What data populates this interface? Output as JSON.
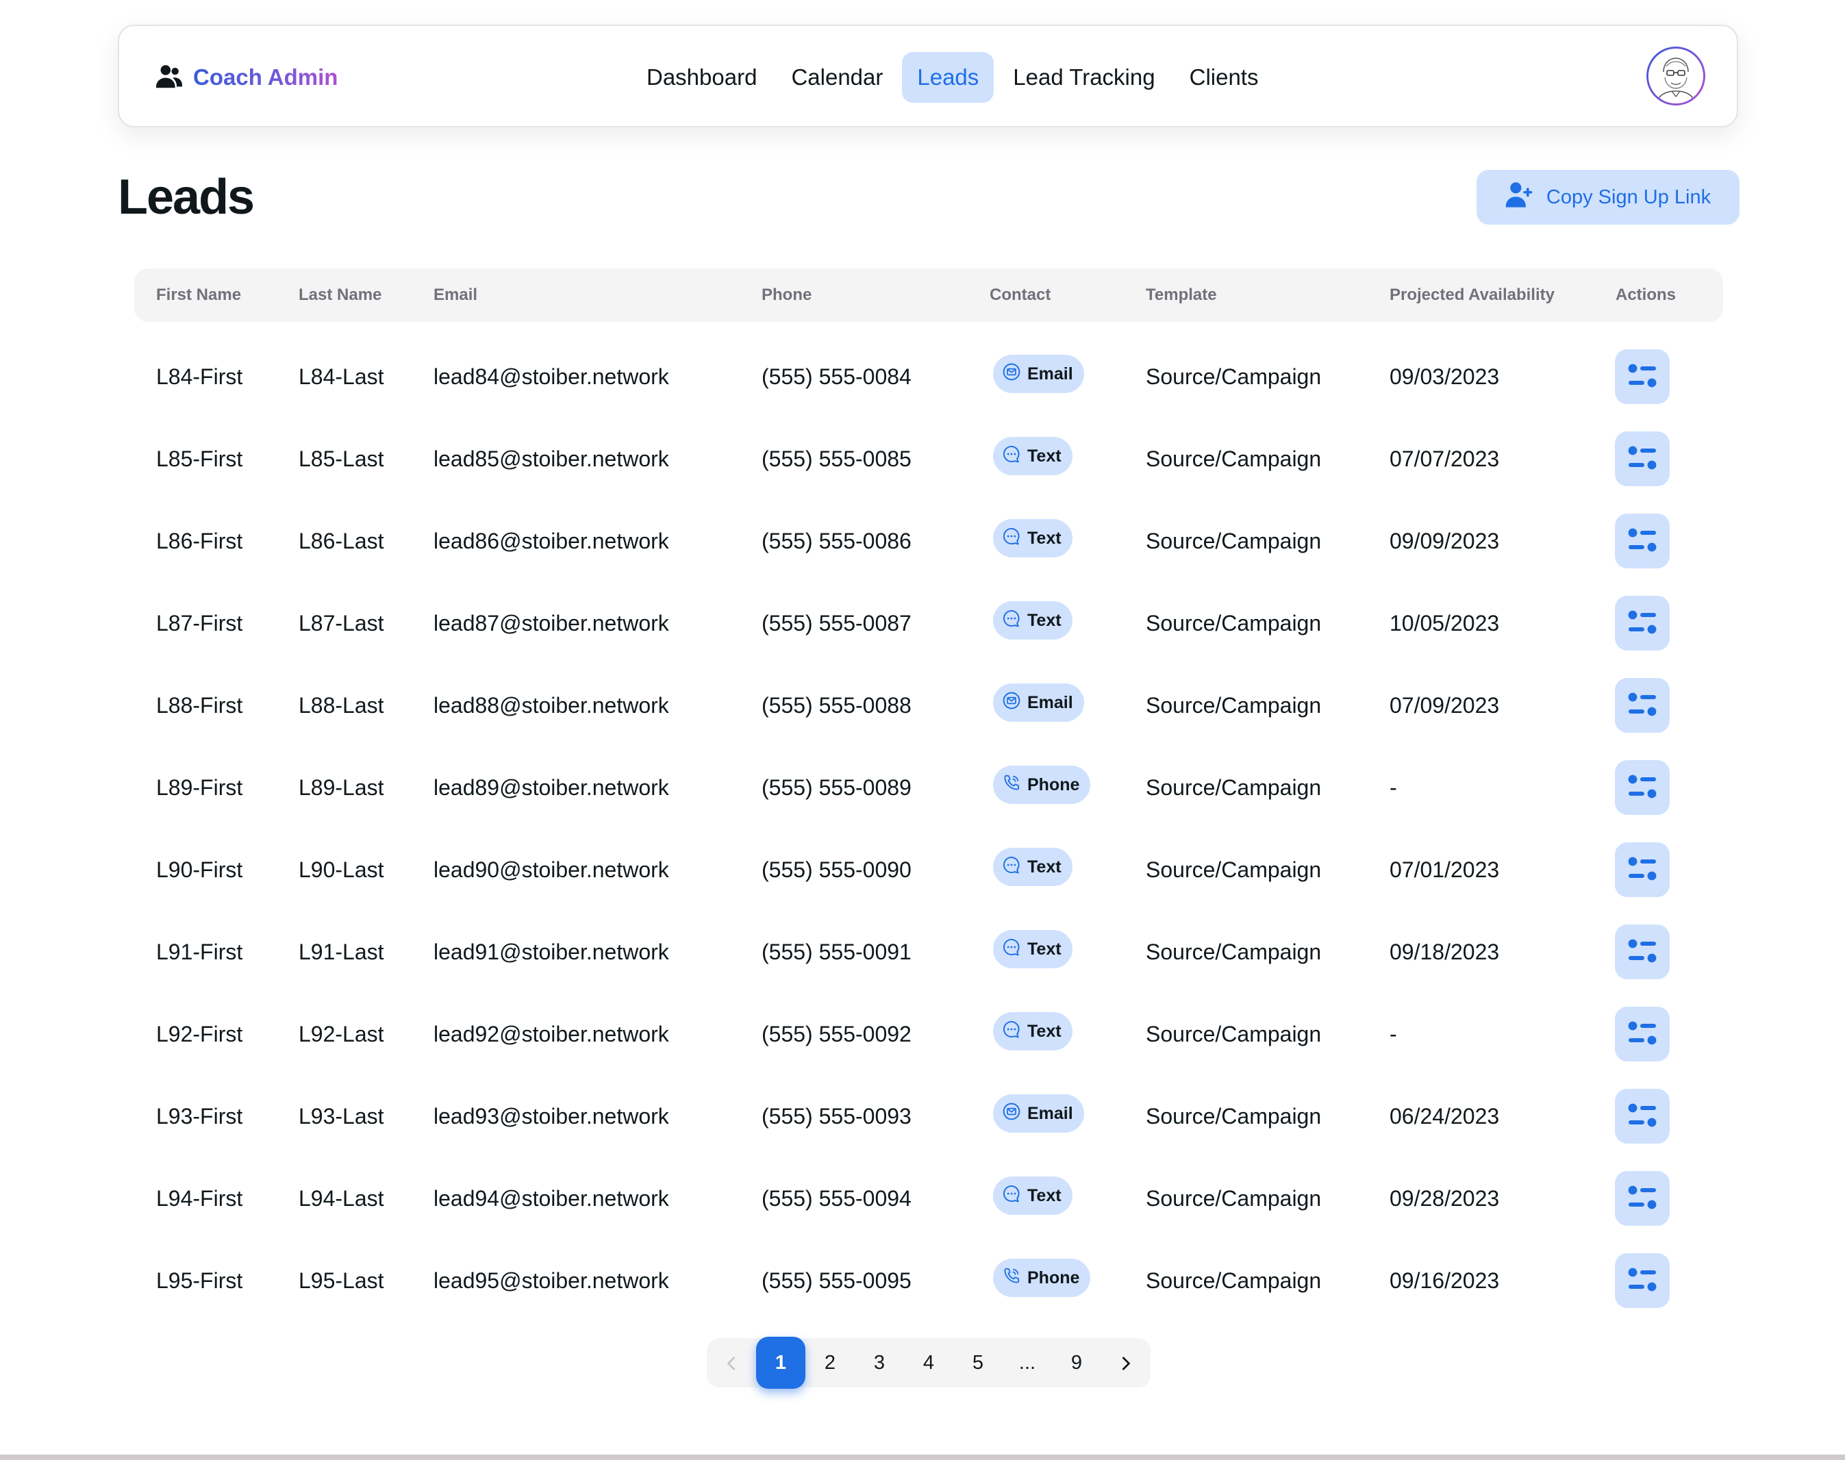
{
  "nav": {
    "brand": "Coach Admin",
    "links": [
      "Dashboard",
      "Calendar",
      "Leads",
      "Lead Tracking",
      "Clients"
    ],
    "active": "Leads",
    "brand_icon": "users-icon",
    "avatar_icon": "avatar-glasses-icon"
  },
  "page": {
    "title": "Leads",
    "copy_button": "Copy Sign Up Link",
    "copy_button_icon": "user-plus-icon"
  },
  "table": {
    "columns": [
      "First Name",
      "Last Name",
      "Email",
      "Phone",
      "Contact",
      "Template",
      "Projected Availability",
      "Actions"
    ],
    "rows": [
      {
        "first": "L84-First",
        "last": "L84-Last",
        "email": "lead84@stoiber.network",
        "phone": "(555) 555-0084",
        "contact": "Email",
        "contact_icon": "mail-icon",
        "template": "Source/Campaign",
        "availability": "09/03/2023"
      },
      {
        "first": "L85-First",
        "last": "L85-Last",
        "email": "lead85@stoiber.network",
        "phone": "(555) 555-0085",
        "contact": "Text",
        "contact_icon": "chat-icon",
        "template": "Source/Campaign",
        "availability": "07/07/2023"
      },
      {
        "first": "L86-First",
        "last": "L86-Last",
        "email": "lead86@stoiber.network",
        "phone": "(555) 555-0086",
        "contact": "Text",
        "contact_icon": "chat-icon",
        "template": "Source/Campaign",
        "availability": "09/09/2023"
      },
      {
        "first": "L87-First",
        "last": "L87-Last",
        "email": "lead87@stoiber.network",
        "phone": "(555) 555-0087",
        "contact": "Text",
        "contact_icon": "chat-icon",
        "template": "Source/Campaign",
        "availability": "10/05/2023"
      },
      {
        "first": "L88-First",
        "last": "L88-Last",
        "email": "lead88@stoiber.network",
        "phone": "(555) 555-0088",
        "contact": "Email",
        "contact_icon": "mail-icon",
        "template": "Source/Campaign",
        "availability": "07/09/2023"
      },
      {
        "first": "L89-First",
        "last": "L89-Last",
        "email": "lead89@stoiber.network",
        "phone": "(555) 555-0089",
        "contact": "Phone",
        "contact_icon": "phone-icon",
        "template": "Source/Campaign",
        "availability": "-"
      },
      {
        "first": "L90-First",
        "last": "L90-Last",
        "email": "lead90@stoiber.network",
        "phone": "(555) 555-0090",
        "contact": "Text",
        "contact_icon": "chat-icon",
        "template": "Source/Campaign",
        "availability": "07/01/2023"
      },
      {
        "first": "L91-First",
        "last": "L91-Last",
        "email": "lead91@stoiber.network",
        "phone": "(555) 555-0091",
        "contact": "Text",
        "contact_icon": "chat-icon",
        "template": "Source/Campaign",
        "availability": "09/18/2023"
      },
      {
        "first": "L92-First",
        "last": "L92-Last",
        "email": "lead92@stoiber.network",
        "phone": "(555) 555-0092",
        "contact": "Text",
        "contact_icon": "chat-icon",
        "template": "Source/Campaign",
        "availability": "-"
      },
      {
        "first": "L93-First",
        "last": "L93-Last",
        "email": "lead93@stoiber.network",
        "phone": "(555) 555-0093",
        "contact": "Email",
        "contact_icon": "mail-icon",
        "template": "Source/Campaign",
        "availability": "06/24/2023"
      },
      {
        "first": "L94-First",
        "last": "L94-Last",
        "email": "lead94@stoiber.network",
        "phone": "(555) 555-0094",
        "contact": "Text",
        "contact_icon": "chat-icon",
        "template": "Source/Campaign",
        "availability": "09/28/2023"
      },
      {
        "first": "L95-First",
        "last": "L95-Last",
        "email": "lead95@stoiber.network",
        "phone": "(555) 555-0095",
        "contact": "Phone",
        "contact_icon": "phone-icon",
        "template": "Source/Campaign",
        "availability": "09/16/2023"
      }
    ],
    "action_icon": "list-settings-icon"
  },
  "pagination": {
    "pages": [
      "1",
      "2",
      "3",
      "4",
      "5",
      "...",
      "9"
    ],
    "current": "1",
    "prev_icon": "chevron-left-icon",
    "next_icon": "chevron-right-icon"
  },
  "colors": {
    "accent": "#1f6fe5",
    "accent_soft": "#cfe1fd",
    "header_bg": "#f4f4f5",
    "muted_text": "#71717a",
    "brand_gradient": [
      "#3b5bdb",
      "#b04fd2"
    ]
  }
}
